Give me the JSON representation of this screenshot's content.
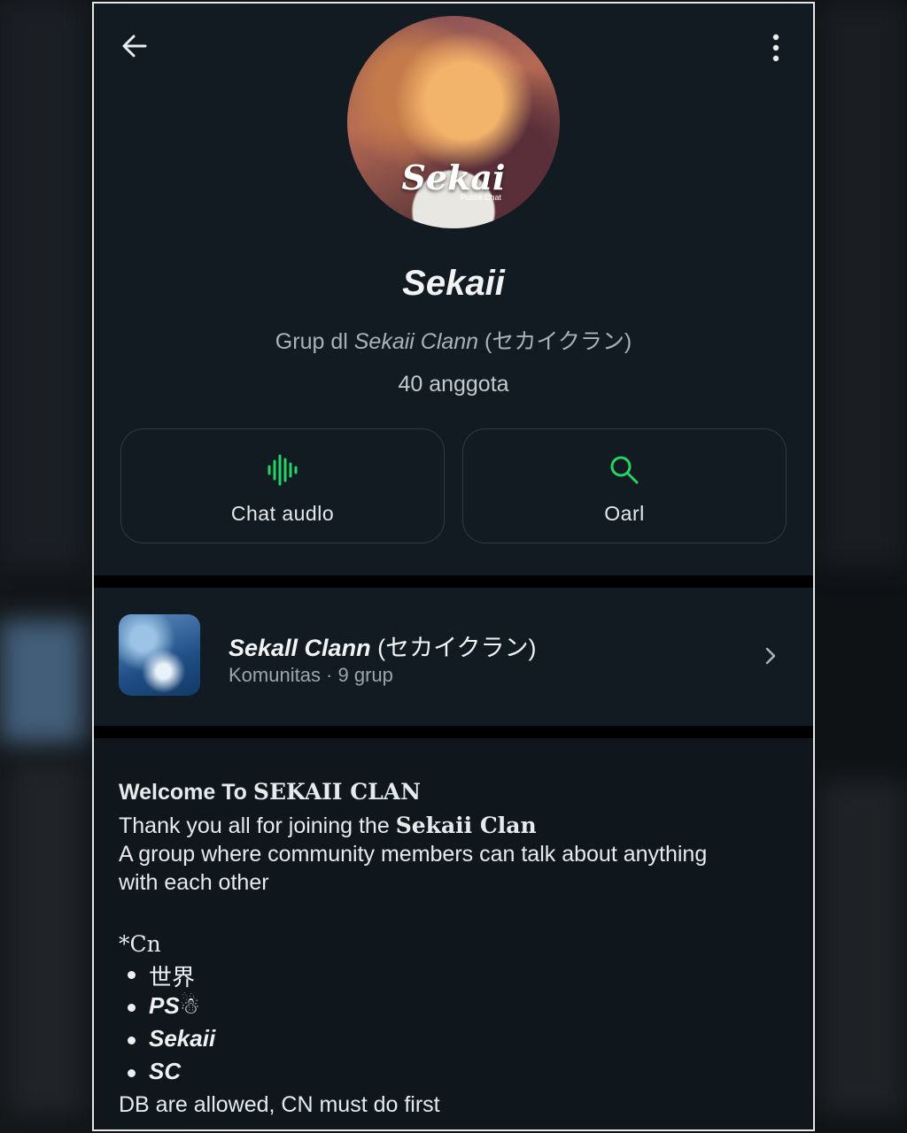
{
  "group": {
    "name": "Sekaii",
    "desc_prefix": "Grup dl",
    "desc_community": "Sekaii Clann",
    "desc_suffix": "(セカイクラン)",
    "member_count": "40 anggota",
    "avatar_text": "Sekai",
    "avatar_sub": "Publik Chat"
  },
  "actions": {
    "audio_label": "Chat audlo",
    "search_label": "Oarl"
  },
  "community": {
    "name_italic": "Sekall Clann",
    "name_suffix": "(セカイクラン)",
    "subtitle": "Komunitas · 9 grup"
  },
  "description": {
    "line1_prefix": "Welcome To",
    "line1_bold": "SEKAII CLAN",
    "line2_prefix": "Thank you all for joining the",
    "line2_bold": "Sekaii Clan",
    "line3": "A group where community members can talk about anything",
    "line4": "with each other",
    "cn_label": "*Cn",
    "bullets": [
      "世界",
      "PS☃︎",
      "Sekaii",
      "SC"
    ],
    "last_line": "DB are allowed, CN must do first"
  },
  "colors": {
    "accent_green": "#25d366",
    "background": "#111b21"
  },
  "icons": [
    "back-arrow-icon",
    "more-vert-icon",
    "audio-wave-icon",
    "search-icon",
    "chevron-right-icon"
  ]
}
